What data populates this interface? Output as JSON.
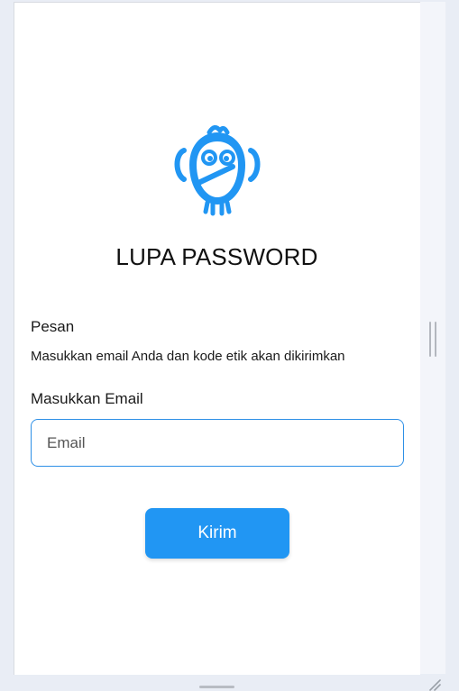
{
  "page": {
    "title": "LUPA PASSWORD",
    "message_label": "Pesan",
    "message_text": "Masukkan email Anda dan kode etik akan dikirimkan",
    "email_label": "Masukkan Email",
    "email_placeholder": "Email",
    "email_value": "",
    "submit_label": "Kirim"
  },
  "icons": {
    "logo": "owl-logo-icon",
    "scrollbar": "scrollbar-handle",
    "resize": "resize-grip-icon"
  },
  "colors": {
    "accent": "#2196f3",
    "input_border": "#2d8fe6",
    "background": "#e9edf5",
    "panel": "#ffffff",
    "text": "#111111"
  }
}
